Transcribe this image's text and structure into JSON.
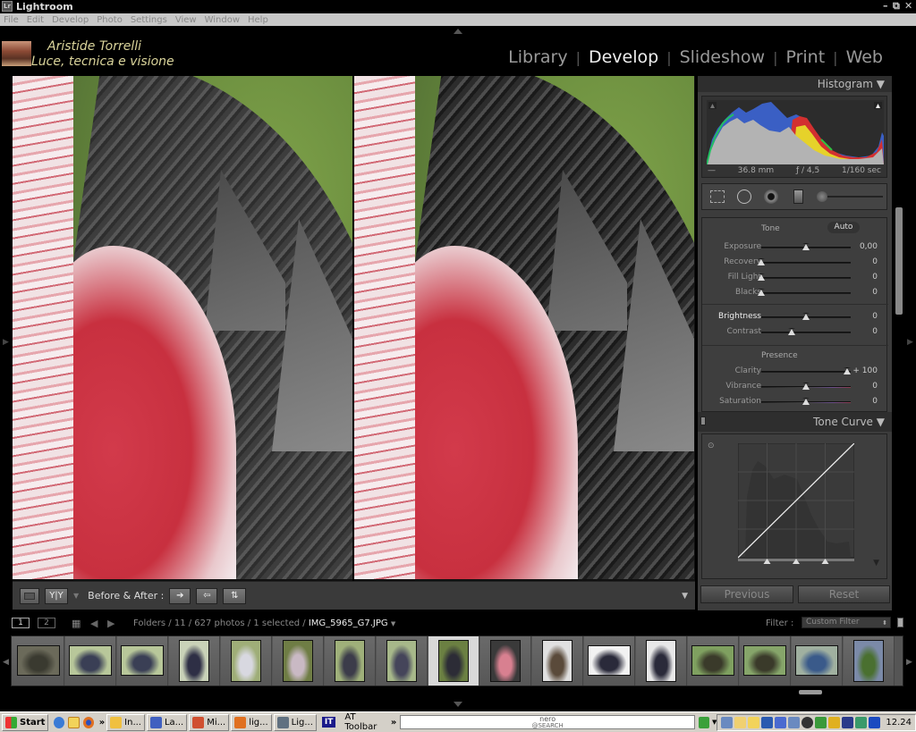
{
  "window": {
    "app_title": "Lightroom",
    "app_icon": "Lr",
    "controls": [
      "minimize-icon",
      "restore-icon",
      "close-icon"
    ]
  },
  "menubar": [
    "File",
    "Edit",
    "Develop",
    "Photo",
    "Settings",
    "View",
    "Window",
    "Help"
  ],
  "identity": {
    "line1": "Aristide Torrelli",
    "line2": "Luce, tecnica e visione",
    "text_color": "#d9d39a"
  },
  "modules": {
    "items": [
      "Library",
      "Develop",
      "Slideshow",
      "Print",
      "Web"
    ],
    "active": "Develop",
    "separator": "|"
  },
  "viewer": {
    "mode": "Before & After side-by-side",
    "toolbar": {
      "loupe_icon": "loupe-view-icon",
      "yy_label": "Y|Y",
      "before_after_label": "Before & After :",
      "copy_before_to_after": "➔",
      "copy_after_to_before": "⇦",
      "swap": "⇅",
      "menu_triangle": "▼"
    }
  },
  "right_panel": {
    "histogram": {
      "title": "Histogram",
      "focal_length": "36.8 mm",
      "aperture": "ƒ / 4,5",
      "shutter": "1/160 sec",
      "iso": "—"
    },
    "tools": [
      "crop-overlay-icon",
      "spot-removal-icon",
      "red-eye-icon",
      "graduated-filter-icon",
      "adjustment-brush-icon"
    ],
    "basic": {
      "tone": {
        "label": "Tone",
        "auto_label": "Auto",
        "sliders": [
          {
            "label": "Exposure",
            "value": "0,00",
            "pos": 0.5
          },
          {
            "label": "Recovery",
            "value": "0",
            "pos": 0.0
          },
          {
            "label": "Fill Light",
            "value": "0",
            "pos": 0.0
          },
          {
            "label": "Blacks",
            "value": "0",
            "pos": 0.0
          }
        ],
        "sliders2": [
          {
            "label": "Brightness",
            "value": "0",
            "pos": 0.5,
            "highlight": true
          },
          {
            "label": "Contrast",
            "value": "0",
            "pos": 0.34
          }
        ]
      },
      "presence": {
        "label": "Presence",
        "sliders": [
          {
            "label": "Clarity",
            "value": "+ 100",
            "pos": 0.96
          },
          {
            "label": "Vibrance",
            "value": "0",
            "pos": 0.5
          },
          {
            "label": "Saturation",
            "value": "0",
            "pos": 0.5
          }
        ]
      }
    },
    "tone_curve": {
      "title": "Tone Curve",
      "split_points": [
        0.25,
        0.5,
        0.75
      ]
    },
    "buttons": {
      "previous": "Previous",
      "reset": "Reset"
    }
  },
  "filmstrip_bar": {
    "page1": "1",
    "page2": "2",
    "path": "Folders / 11 / 627 photos / 1 selected / ",
    "filename": "IMG_5965_G7.JPG",
    "filter_label": "Filter :",
    "filter_value": "Custom Filter"
  },
  "filmstrip": {
    "selected_index": 8,
    "thumbs": [
      {
        "desc": "rocky ground",
        "c1": "#6b6a5a",
        "c2": "#3a3a30",
        "orient": "land"
      },
      {
        "desc": "turkey",
        "c1": "#b8c79a",
        "c2": "#3a3f55",
        "orient": "land"
      },
      {
        "desc": "turkey",
        "c1": "#b8c79a",
        "c2": "#3a3f55",
        "orient": "land"
      },
      {
        "desc": "turkey",
        "c1": "#c9d2b8",
        "c2": "#2e2f45",
        "orient": "port"
      },
      {
        "desc": "hen and turkey",
        "c1": "#9fae78",
        "c2": "#d8d8e0",
        "orient": "port"
      },
      {
        "desc": "turkey on grass",
        "c1": "#6f7d45",
        "c2": "#c9b9c4",
        "orient": "port"
      },
      {
        "desc": "turkey",
        "c1": "#9fb07a",
        "c2": "#3c3c4a",
        "orient": "port"
      },
      {
        "desc": "turkey",
        "c1": "#a7b88a",
        "c2": "#45455a",
        "orient": "port"
      },
      {
        "desc": "turkey closeup",
        "c1": "#6b8042",
        "c2": "#2c2c36",
        "orient": "port"
      },
      {
        "desc": "turkey head",
        "c1": "#3a3a3a",
        "c2": "#d88090",
        "orient": "port"
      },
      {
        "desc": "turkey head bw",
        "c1": "#e0e0e0",
        "c2": "#5a4a3a",
        "orient": "port"
      },
      {
        "desc": "turkey head white bg",
        "c1": "#f2f2f2",
        "c2": "#2a2a3a",
        "orient": "land"
      },
      {
        "desc": "turkey head",
        "c1": "#e8e8e8",
        "c2": "#2a2a3a",
        "orient": "port"
      },
      {
        "desc": "park with birds",
        "c1": "#7fa060",
        "c2": "#3a3a2a",
        "orient": "land"
      },
      {
        "desc": "park with birds",
        "c1": "#86a56a",
        "c2": "#3a3a2a",
        "orient": "land"
      },
      {
        "desc": "children in park",
        "c1": "#a0b0a0",
        "c2": "#3a5a8a",
        "orient": "land"
      },
      {
        "desc": "park trees",
        "c1": "#7b8aa8",
        "c2": "#4a7030",
        "orient": "port"
      }
    ]
  },
  "taskbar": {
    "start": "Start",
    "quicklaunch": [
      "ie-icon",
      "clock-icon",
      "firefox-icon"
    ],
    "chevron": "»",
    "tasks": [
      {
        "label": "In...",
        "icon": "clock-icon",
        "color": "#f0c040"
      },
      {
        "label": "La...",
        "icon": "word-icon",
        "color": "#4060c0"
      },
      {
        "label": "Mi...",
        "icon": "app-icon",
        "color": "#d05030"
      },
      {
        "label": "lig...",
        "icon": "firefox-icon",
        "color": "#e07020"
      },
      {
        "label": "Lig...",
        "icon": "lightroom-icon",
        "color": "#607080"
      }
    ],
    "it_badge": "IT",
    "toolbar_label": "AT Toolbar",
    "search_brand": "nero",
    "search_sub": "@SEARCH",
    "clock": "12.24"
  }
}
